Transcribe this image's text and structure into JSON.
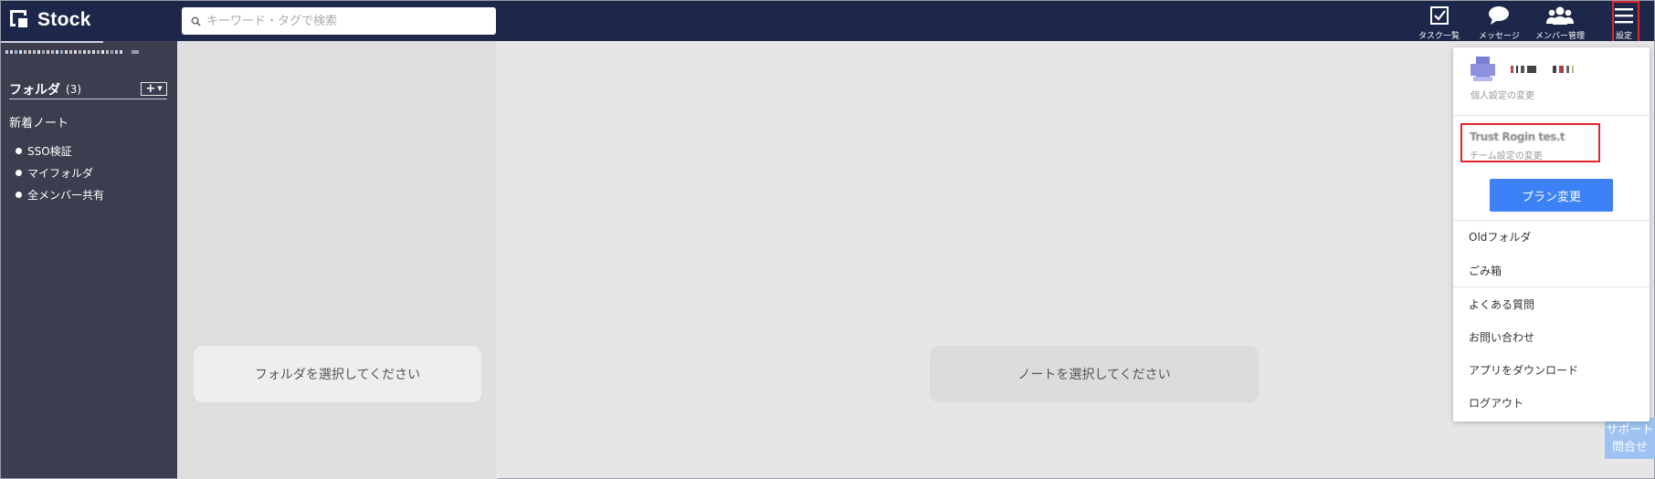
{
  "app": {
    "name": "Stock"
  },
  "search": {
    "placeholder": "キーワード・タグで検索"
  },
  "header_actions": [
    {
      "label": "タスク一覧",
      "icon": "task-checkbox-icon"
    },
    {
      "label": "メッセージ",
      "icon": "chat-bubble-icon"
    },
    {
      "label": "メンバー管理",
      "icon": "members-icon"
    },
    {
      "label": "設定",
      "icon": "menu-icon"
    }
  ],
  "sidebar": {
    "folder_heading": "フォルダ",
    "folder_count": "(3)",
    "add_label": "+",
    "new_notes": "新着ノート",
    "folders": [
      "SSO検証",
      "マイフォルダ",
      "全メンバー共有"
    ]
  },
  "panes": {
    "folder_placeholder": "フォルダを選択してください",
    "note_placeholder": "ノートを選択してください"
  },
  "support": {
    "line1": "サポート",
    "line2": "問合せ"
  },
  "dropdown": {
    "personal_settings": "個人設定の変更",
    "team_name": "Trust Rogin tes.t",
    "team_settings": "チーム設定の変更",
    "plan_button": "プラン変更",
    "items_group1": [
      "Oldフォルダ",
      "ごみ箱"
    ],
    "items_group2": [
      "よくある質問",
      "お問い合わせ",
      "アプリをダウンロード",
      "ログアウト"
    ]
  },
  "colors": {
    "header_bg": "#1d2749",
    "sidebar_bg": "#3c3e4f",
    "accent": "#3c82f6",
    "highlight": "#e0262b"
  }
}
